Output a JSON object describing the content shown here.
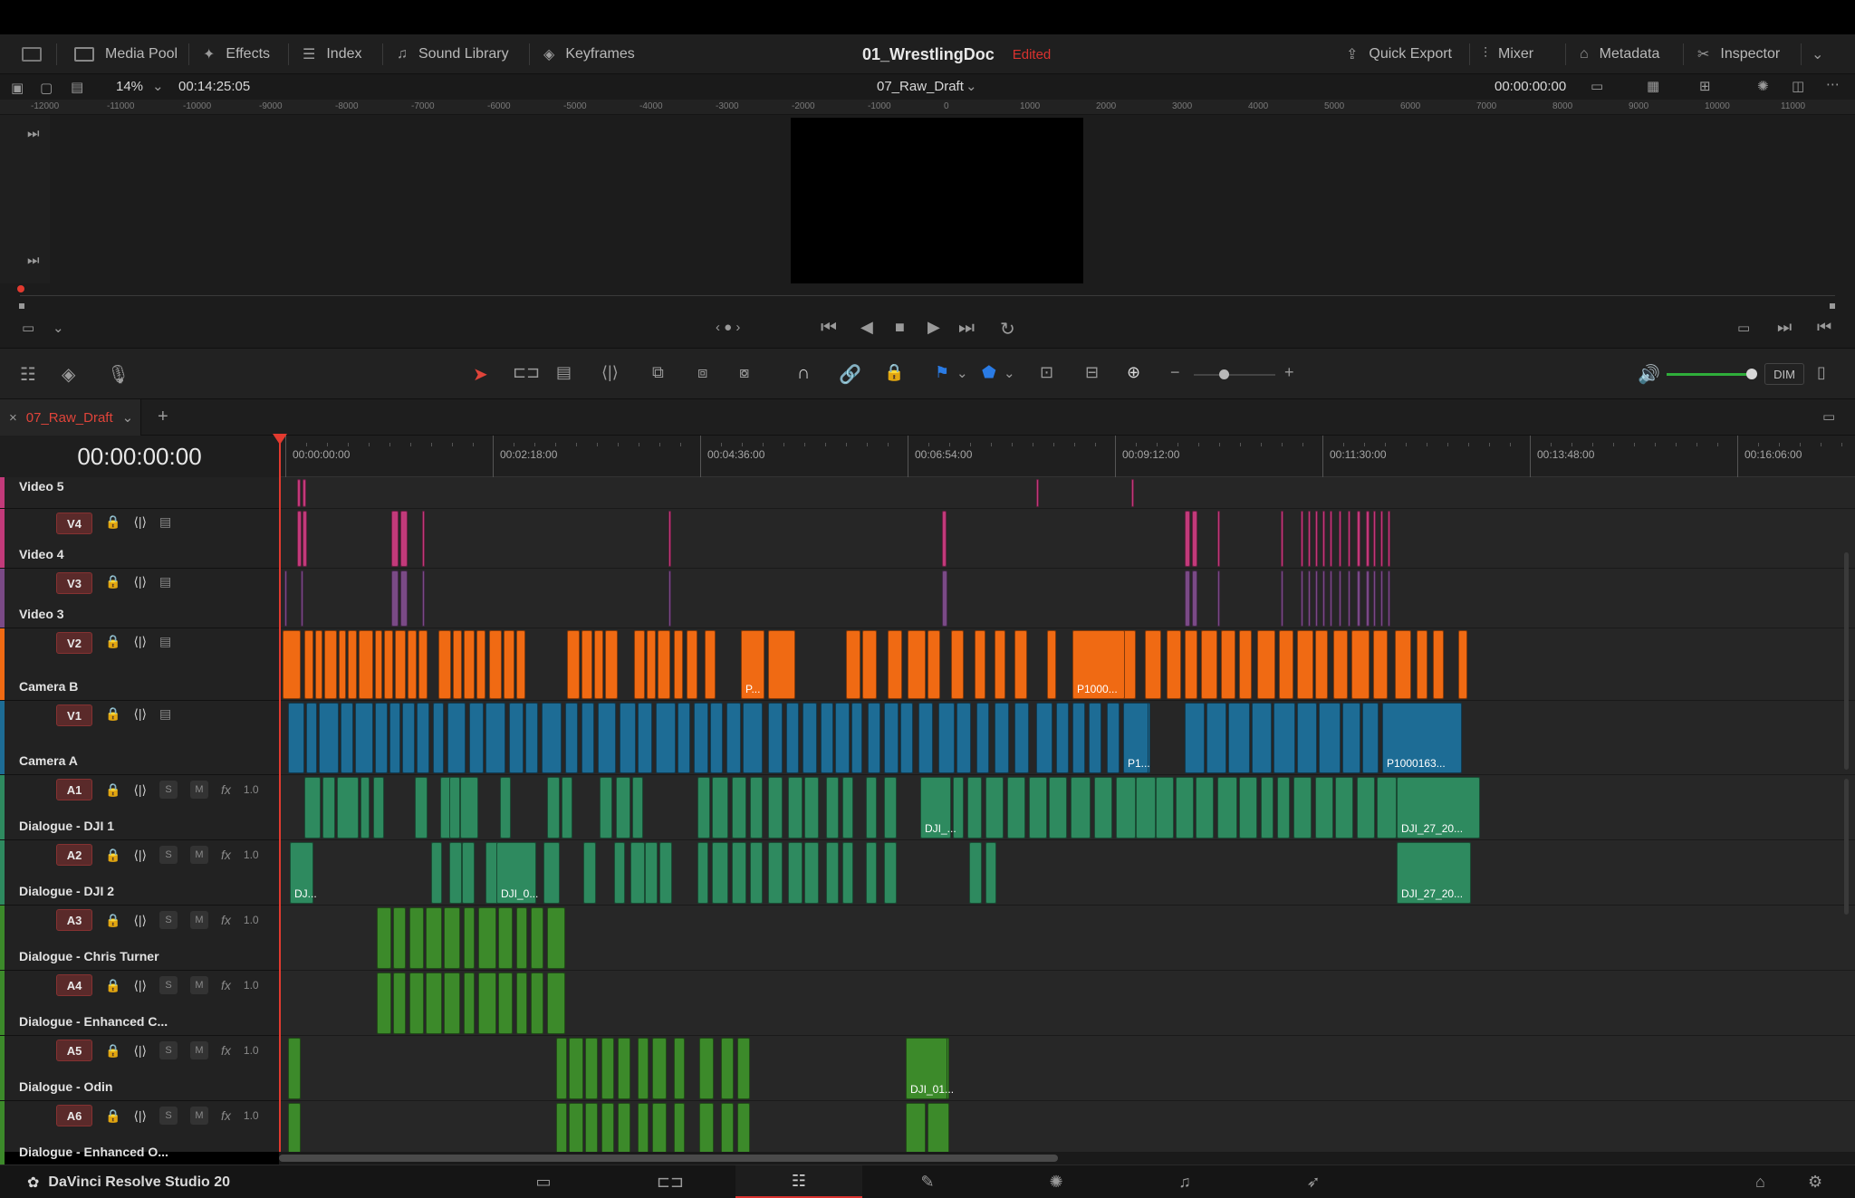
{
  "topbar": {
    "media_pool": "Media Pool",
    "effects": "Effects",
    "index": "Index",
    "sound_library": "Sound Library",
    "keyframes": "Keyframes",
    "project_name": "01_WrestlingDoc",
    "project_state": "Edited",
    "quick_export": "Quick Export",
    "mixer": "Mixer",
    "metadata": "Metadata",
    "inspector": "Inspector"
  },
  "viewer": {
    "zoom": "14%",
    "duration": "00:14:25:05",
    "timeline_name": "07_Raw_Draft",
    "timecode": "00:00:00:00",
    "ruler_ticks": [
      "-12000",
      "-11000",
      "-10000",
      "-9000",
      "-8000",
      "-7000",
      "-6000",
      "-5000",
      "-4000",
      "-3000",
      "-2000",
      "-1000",
      "0",
      "1000",
      "2000",
      "3000",
      "4000",
      "5000",
      "6000",
      "7000",
      "8000",
      "9000",
      "10000",
      "11000"
    ]
  },
  "toolbar": {
    "dim_label": "DIM",
    "volume_level": 0.95
  },
  "timeline": {
    "tab_name": "07_Raw_Draft",
    "current_timecode": "00:00:00:00",
    "ticks": [
      "00:00:00:00",
      "00:02:18:00",
      "00:04:36:00",
      "00:06:54:00",
      "00:09:12:00",
      "00:11:30:00",
      "00:13:48:00",
      "00:16:06:00"
    ],
    "tracks": [
      {
        "id": "",
        "name": "Video 5",
        "type": "video"
      },
      {
        "id": "V4",
        "name": "Video 4",
        "type": "video"
      },
      {
        "id": "V3",
        "name": "Video 3",
        "type": "video"
      },
      {
        "id": "V2",
        "name": "Camera B",
        "type": "video"
      },
      {
        "id": "V1",
        "name": "Camera A",
        "type": "video"
      },
      {
        "id": "A1",
        "name": "Dialogue - DJI 1",
        "type": "audio",
        "level": "1.0"
      },
      {
        "id": "A2",
        "name": "Dialogue - DJI 2",
        "type": "audio",
        "level": "1.0"
      },
      {
        "id": "A3",
        "name": "Dialogue - Chris Turner",
        "type": "audio",
        "level": "1.0"
      },
      {
        "id": "A4",
        "name": "Dialogue -  Enhanced C...",
        "type": "audio",
        "level": "1.0"
      },
      {
        "id": "A5",
        "name": "Dialogue - Odin",
        "type": "audio",
        "level": "1.0"
      },
      {
        "id": "A6",
        "name": "Dialogue - Enhanced O...",
        "type": "audio",
        "level": "1.0"
      }
    ],
    "clip_labels": {
      "v2_a": "P...",
      "v2_b": "P1000...",
      "v1_a": "P1...",
      "v1_b": "P1000163...",
      "a1_a": "DJI_...",
      "a1_b": "DJI_27_20...",
      "a2_a": "DJ...",
      "a2_b": "DJI_0...",
      "a2_c": "DJI_27_20...",
      "a5_a": "DJI_01..."
    }
  },
  "bottombar": {
    "brand": "DaVinci Resolve Studio 20"
  },
  "colors": {
    "pink": "#c23a7a",
    "purple": "#7a4a86",
    "orange": "#f06a13",
    "blue": "#1d6c95",
    "green_teal": "#2e8a5f",
    "green": "#3c8a2a",
    "accent_red": "#d9322f"
  }
}
